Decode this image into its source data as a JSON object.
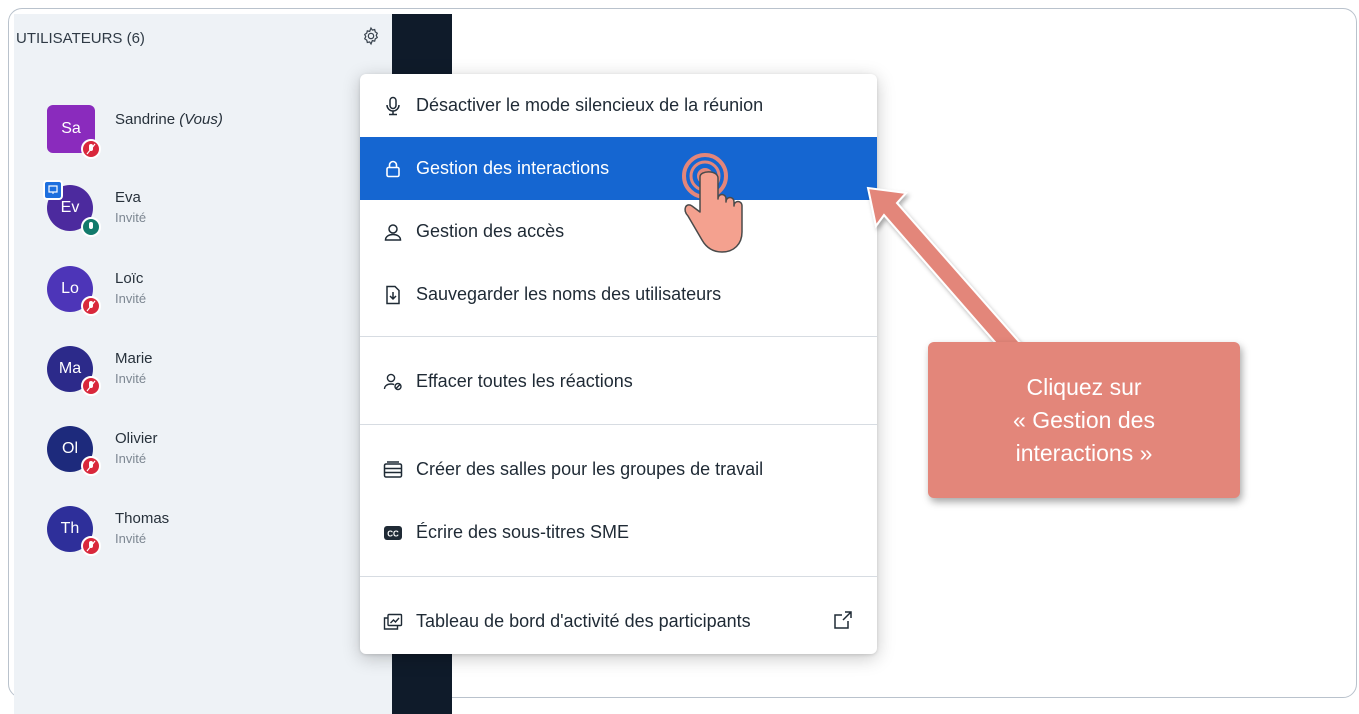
{
  "panel": {
    "header": "UTILISATEURS (6)",
    "users": [
      {
        "initials": "Sa",
        "name": "Sandrine",
        "tag": "(Vous)",
        "role": "",
        "color": "#8a2bbd",
        "square": true,
        "mic": "muted",
        "presenter": false
      },
      {
        "initials": "Ev",
        "name": "Eva",
        "tag": "",
        "role": "Invité",
        "color": "#4c2a9e",
        "square": false,
        "mic": "on",
        "presenter": true
      },
      {
        "initials": "Lo",
        "name": "Loïc",
        "tag": "",
        "role": "Invité",
        "color": "#4d35b8",
        "square": false,
        "mic": "muted",
        "presenter": false
      },
      {
        "initials": "Ma",
        "name": "Marie",
        "tag": "",
        "role": "Invité",
        "color": "#2c2a8a",
        "square": false,
        "mic": "muted",
        "presenter": false
      },
      {
        "initials": "Ol",
        "name": "Olivier",
        "tag": "",
        "role": "Invité",
        "color": "#1d2a7c",
        "square": false,
        "mic": "muted",
        "presenter": false
      },
      {
        "initials": "Th",
        "name": "Thomas",
        "tag": "",
        "role": "Invité",
        "color": "#2e2f9a",
        "square": false,
        "mic": "muted",
        "presenter": false
      }
    ]
  },
  "menu": {
    "items": [
      {
        "label": "Désactiver le mode silencieux de la réunion",
        "icon": "microphone-icon"
      },
      {
        "label": "Gestion des interactions",
        "icon": "lock-icon"
      },
      {
        "label": "Gestion des accès",
        "icon": "user-icon"
      },
      {
        "label": "Sauvegarder les noms des utilisateurs",
        "icon": "download-file-icon"
      },
      {
        "label": "Effacer toutes les réactions",
        "icon": "clear-reactions-icon"
      },
      {
        "label": "Créer des salles pour les groupes de travail",
        "icon": "breakout-rooms-icon"
      },
      {
        "label": "Écrire des sous-titres SME",
        "icon": "closed-captions-icon"
      },
      {
        "label": "Tableau de bord d'activité des participants",
        "icon": "dashboard-icon"
      }
    ]
  },
  "callout": {
    "line1": "Cliquez sur",
    "line2": "« Gestion des",
    "line3": "interactions »"
  },
  "colors": {
    "accent": "#1566d1",
    "callout": "#e3867a",
    "muted": "#d9283c",
    "unmuted": "#127a6b"
  }
}
